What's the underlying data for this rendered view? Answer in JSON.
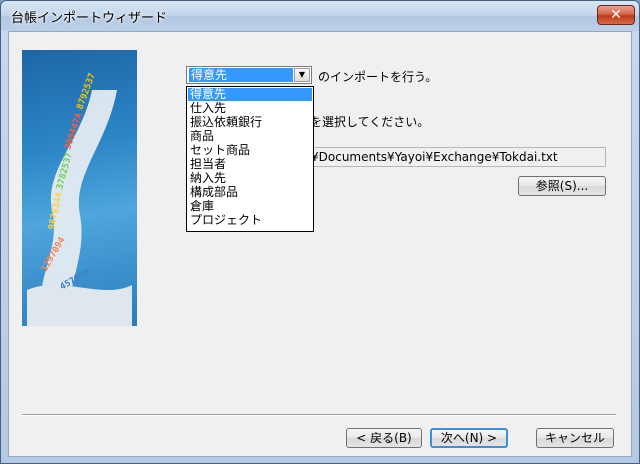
{
  "window": {
    "title": "台帳インポートウィザード",
    "close_glyph": "✕"
  },
  "import_type": {
    "selected": "得意先",
    "arrow_glyph": "▼",
    "suffix_label": "のインポートを行う。",
    "options": [
      "得意先",
      "仕入先",
      "振込依頼銀行",
      "商品",
      "セット商品",
      "担当者",
      "納入先",
      "構成部品",
      "倉庫",
      "プロジェクト"
    ]
  },
  "file_select": {
    "label_partial": "を選択してください。",
    "path_partial": "¥Documents¥Yayoi¥Exchange¥Tokdai.txt",
    "browse_label": "参照(S)..."
  },
  "footer": {
    "back_label": "< 戻る(B)",
    "next_label": "次へ(N) >",
    "cancel_label": "キャンセル"
  },
  "colors": {
    "selection": "#3399ff",
    "titlebar": "#c0d4ea",
    "banner": "#2c86c6"
  }
}
